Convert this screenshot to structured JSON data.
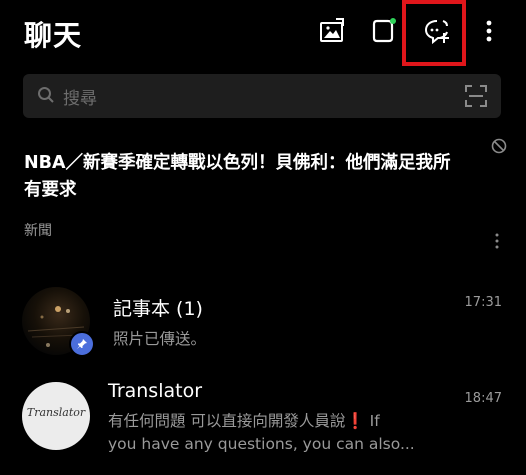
{
  "header": {
    "title": "聊天",
    "icons": [
      "album-icon",
      "keep-icon",
      "new-chat-icon",
      "more-vert-icon"
    ],
    "keep_badge_color": "#2fd35a",
    "highlight_color": "#e0161b"
  },
  "search": {
    "placeholder": "搜尋",
    "icons": [
      "search-icon",
      "qr-scan-icon"
    ]
  },
  "news": {
    "title": "NBA／新賽季確定轉戰以色列！貝佛利：他們滿足我所有要求",
    "tag": "新聞"
  },
  "chats": [
    {
      "name": "記事本 (1)",
      "message": "照片已傳送。",
      "time": "17:31",
      "pinned": true
    },
    {
      "name": "Translator",
      "avatar_text": "Translator",
      "message_line1": "有任何問題 可以直接向開發人員說",
      "red_mark": "❗",
      "message_line1_end": " If",
      "message_line2": "you have any questions, you can also...",
      "time": "18:47"
    }
  ],
  "colors": {
    "background": "#000000",
    "search_bg": "#1e1e1e",
    "pin_badge": "#4b6edc",
    "secondary_text": "#9a9a9a"
  }
}
